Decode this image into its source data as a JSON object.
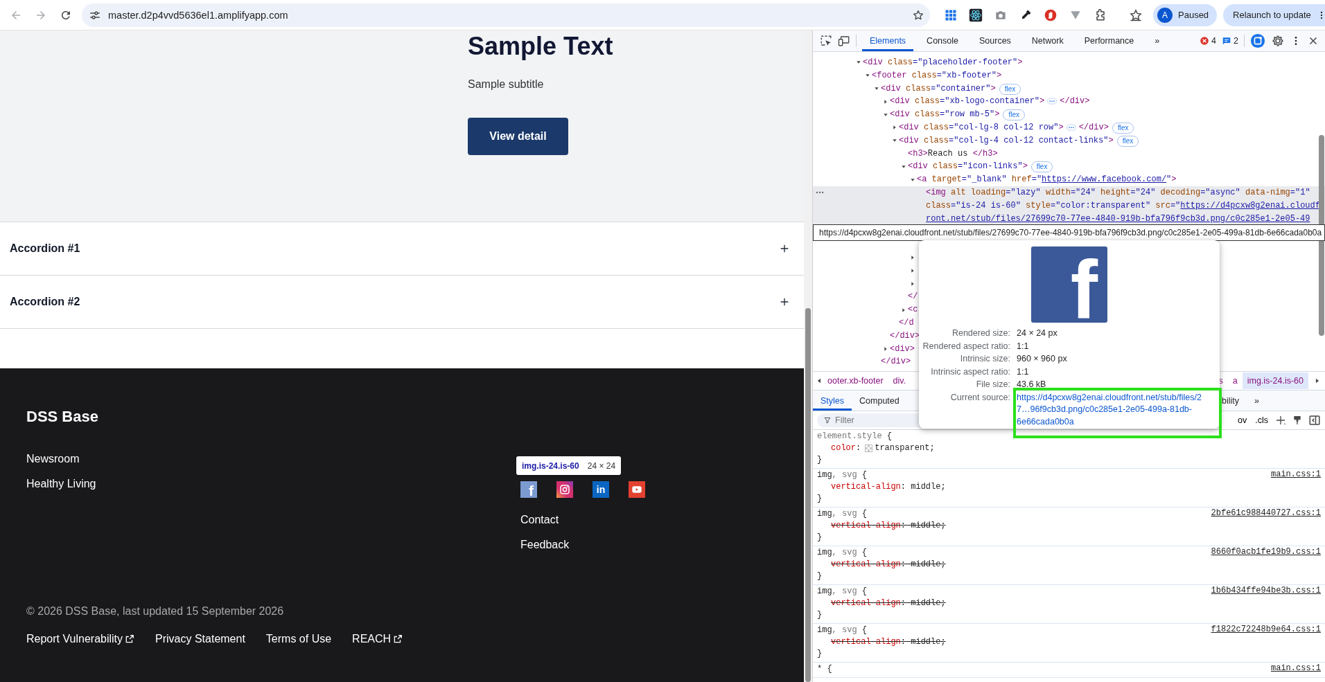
{
  "browser": {
    "url": "master.d2p4vvd5636el1.amplifyapp.com",
    "profile_initial": "A",
    "profile_status": "Paused",
    "update_button": "Relaunch to update"
  },
  "page": {
    "hero": {
      "title": "Sample Text",
      "subtitle": "Sample subtitle",
      "button": "View detail"
    },
    "accordions": [
      {
        "label": "Accordion #1",
        "expanded": false
      },
      {
        "label": "Accordion #2",
        "expanded": false
      }
    ],
    "footer": {
      "brand": "DSS Base",
      "links": [
        "Newsroom",
        "Healthy Living"
      ],
      "social": [
        {
          "kind": "letter",
          "glyph": "f",
          "color": "#7b9bd1"
        },
        {
          "kind": "camera",
          "color": "#d6306f"
        },
        {
          "kind": "letter",
          "glyph": "in",
          "color": "#0a66c2"
        },
        {
          "kind": "video",
          "color": "#e2412f"
        }
      ],
      "inspect_tooltip": {
        "selector": "img.is-24.is-60",
        "size": "24 × 24"
      },
      "contact_links": [
        "Contact",
        "Feedback"
      ],
      "copyright": "© 2026 DSS Base, last updated 15 September 2026",
      "bottom_links": [
        {
          "label": "Report Vulnerability",
          "external": true
        },
        {
          "label": "Privacy Statement",
          "external": false
        },
        {
          "label": "Terms of Use",
          "external": false
        },
        {
          "label": "REACH",
          "external": true
        }
      ]
    }
  },
  "devtools": {
    "tabs": [
      {
        "label": "Elements",
        "selected": true
      },
      {
        "label": "Console",
        "selected": false
      },
      {
        "label": "Sources",
        "selected": false
      },
      {
        "label": "Network",
        "selected": false
      },
      {
        "label": "Performance",
        "selected": false
      }
    ],
    "more_tabs": "»",
    "errors": "4",
    "messages": "2",
    "dom_tree": [
      {
        "kind": "branch",
        "expanded": true,
        "selected": false,
        "line": "<div class=\"placeholder-footer\">",
        "children": [
          {
            "kind": "branch",
            "expanded": true,
            "selected": false,
            "line": "<footer class=\"xb-footer\">",
            "children": [
              {
                "kind": "branch",
                "expanded": true,
                "selected": false,
                "line": "<div class=\"container\">",
                "badge": "flex",
                "close": "</div>",
                "children": [
                  {
                    "kind": "branch",
                    "expanded": false,
                    "selected": false,
                    "line": "<div class=\"xb-logo-container\">",
                    "tail": "</div>"
                  },
                  {
                    "kind": "branch",
                    "expanded": true,
                    "selected": false,
                    "line": "<div class=\"row mb-5\">",
                    "badge": "flex",
                    "close": "</div>",
                    "children": [
                      {
                        "kind": "branch",
                        "expanded": false,
                        "selected": false,
                        "line": "<div class=\"col-lg-8 col-12 row\">",
                        "tail": "</div>",
                        "badge": "flex"
                      },
                      {
                        "kind": "branch",
                        "expanded": true,
                        "selected": false,
                        "line": "<div class=\"col-lg-4 col-12 contact-links\">",
                        "badge": "flex",
                        "close": "</d",
                        "children": [
                          {
                            "kind": "leaf",
                            "selected": false,
                            "line": "<h3>Reach us </h3>"
                          },
                          {
                            "kind": "branch",
                            "expanded": true,
                            "selected": false,
                            "line": "<div class=\"icon-links\">",
                            "badge": "flex",
                            "close": "</",
                            "children": [
                              {
                                "kind": "branch",
                                "expanded": true,
                                "selected": false,
                                "line": "<a target=\"_blank\" href=\"https://www.facebook.com/\">",
                                "children": [
                                  {
                                    "kind": "leaf",
                                    "selected": true,
                                    "line": "<img alt loading=\"lazy\" width=\"24\" height=\"24\" decoding=\"async\" data-nimg=\"1\" class=\"is-24 is-60\" style=\"color:transparent\" src=\"https://d4pcxw8g2enai.cloudfront.net/stub/files/27699c70-77ee-4840-919b-bfa796f9cb3d.png/c0c285e1-2e05-49"
                                  }
                                ]
                              },
                              {
                                "kind": "branch",
                                "expanded": false,
                                "selected": false
                              },
                              {
                                "kind": "branch",
                                "expanded": false,
                                "selected": false
                              },
                              {
                                "kind": "branch",
                                "expanded": false,
                                "selected": false
                              }
                            ]
                          },
                          {
                            "kind": "branch",
                            "expanded": false,
                            "selected": false,
                            "line": "<c"
                          }
                        ]
                      }
                    ]
                  },
                  {
                    "kind": "branch",
                    "expanded": false,
                    "selected": false,
                    "line": "<div>"
                  }
                ]
              }
            ]
          }
        ]
      }
    ],
    "url_tooltip": "https://d4pcxw8g2enai.cloudfront.net/stub/files/27699c70-77ee-4840-919b-bfa796f9cb3d.png/c0c285e1-2e05-499a-81db-6e66cada0b0a",
    "breadcrumbs_left": [
      {
        "label": "ooter.xb-footer",
        "selected": false
      },
      {
        "label": "div.",
        "selected": false
      }
    ],
    "breadcrumbs_right": [
      {
        "label": "s",
        "selected": false
      },
      {
        "label": "a",
        "selected": false
      },
      {
        "label": "img.is-24.is-60",
        "selected": true
      }
    ],
    "pane_tabs": [
      {
        "label": "Styles",
        "selected": true
      },
      {
        "label": "Computed",
        "selected": false
      }
    ],
    "pane_tabs_right": [
      "bility"
    ],
    "pane_more": "»",
    "filter_placeholder": "Filter",
    "filter_tools": [
      "ov",
      ".cls"
    ],
    "rules": [
      {
        "selector": [
          {
            "text": "element.style",
            "matched": false
          }
        ],
        "open": "{",
        "close": "}",
        "declarations": [
          {
            "property": "color",
            "separator": ":",
            "value": "transparent;",
            "swatch": true,
            "overridden": false
          }
        ]
      },
      {
        "selector": [
          {
            "text": "img",
            "matched": true
          },
          {
            "text": ", svg",
            "matched": false
          }
        ],
        "open": "{",
        "close": "}",
        "source": "main.css:1",
        "declarations": [
          {
            "property": "vertical-align",
            "separator": ":",
            "value": "middle;",
            "swatch": false,
            "overridden": false
          }
        ]
      },
      {
        "selector": [
          {
            "text": "img",
            "matched": true
          },
          {
            "text": ", svg",
            "matched": false
          }
        ],
        "open": "{",
        "close": "}",
        "source": "2bfe61c988440727.css:1",
        "declarations": [
          {
            "property": "vertical-align",
            "separator": ":",
            "value": "middle;",
            "swatch": false,
            "overridden": true
          }
        ]
      },
      {
        "selector": [
          {
            "text": "img",
            "matched": true
          },
          {
            "text": ", svg",
            "matched": false
          }
        ],
        "open": "{",
        "close": "}",
        "source": "8660f0acb1fe19b9.css:1",
        "declarations": [
          {
            "property": "vertical-align",
            "separator": ":",
            "value": "middle;",
            "swatch": false,
            "overridden": true
          }
        ]
      },
      {
        "selector": [
          {
            "text": "img",
            "matched": true
          },
          {
            "text": ", svg",
            "matched": false
          }
        ],
        "open": "{",
        "close": "}",
        "source": "1b6b434ffe94be3b.css:1",
        "declarations": [
          {
            "property": "vertical-align",
            "separator": ":",
            "value": "middle;",
            "swatch": false,
            "overridden": true
          }
        ]
      },
      {
        "selector": [
          {
            "text": "img",
            "matched": true
          },
          {
            "text": ", svg",
            "matched": false
          }
        ],
        "open": "{",
        "close": "}",
        "source": "f1822c72248b9e64.css:1",
        "declarations": [
          {
            "property": "vertical-align",
            "separator": ":",
            "value": "middle;",
            "swatch": false,
            "overridden": true
          }
        ]
      },
      {
        "selector": [
          {
            "text": "*",
            "matched": true
          }
        ],
        "open": "{",
        "source": "main.css:1"
      }
    ],
    "image_popover": {
      "glyph": "f",
      "rows": [
        {
          "label": "Rendered size:",
          "value": "24 × 24 px"
        },
        {
          "label": "Rendered aspect ratio:",
          "value": "1:1"
        },
        {
          "label": "Intrinsic size:",
          "value": "960 × 960 px"
        },
        {
          "label": "Intrinsic aspect ratio:",
          "value": "1:1"
        },
        {
          "label": "File size:",
          "value": "43.6 kB"
        }
      ],
      "source_label": "Current source:",
      "source_url": "https://d4pcxw8g2enai.cloudfront.net/stub/files/27…96f9cb3d.png/c0c285e1-2e05-499a-81db-6e66cada0b0a",
      "highlight_box": true
    }
  }
}
